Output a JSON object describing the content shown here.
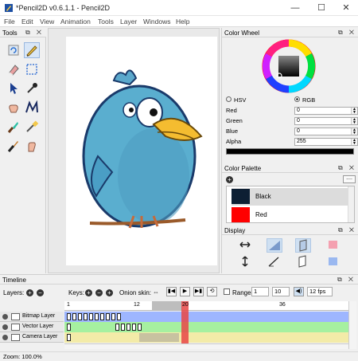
{
  "window": {
    "title": "*Pencil2D v0.6.1.1 - Pencil2D",
    "minimize": "—",
    "maximize": "☐",
    "close": "✕"
  },
  "menu": [
    "File",
    "Edit",
    "View",
    "Animation",
    "Tools",
    "Layer",
    "Windows",
    "Help"
  ],
  "panel_buttons": "⧉ ✕",
  "tools_panel": {
    "title": "Tools"
  },
  "color_wheel": {
    "title": "Color Wheel",
    "hsv_label": "HSV",
    "rgb_label": "RGB",
    "red_label": "Red",
    "red_value": "0",
    "green_label": "Green",
    "green_value": "0",
    "blue_label": "Blue",
    "blue_value": "0",
    "alpha_label": "Alpha",
    "alpha_value": "255",
    "current_color": "#000000"
  },
  "color_palette": {
    "title": "Color Palette",
    "add": "+",
    "menu": "....",
    "items": [
      {
        "name": "Black",
        "color": "#0d1f33"
      },
      {
        "name": "Red",
        "color": "#ff0000"
      }
    ]
  },
  "display": {
    "title": "Display"
  },
  "timeline": {
    "title": "Timeline",
    "layers_label": "Layers:",
    "add": "+",
    "remove": "−",
    "keys_label": "Keys:",
    "onion_label": "Onion skin:",
    "range_label": "Range",
    "range_start": "1",
    "range_end": "10",
    "fps": "12 fps",
    "ruler": [
      "1",
      "12",
      "20",
      "36"
    ],
    "current_frame": 20,
    "layers": [
      {
        "name": "Bitmap Layer",
        "color": "#9eb6ff"
      },
      {
        "name": "Vector Layer",
        "color": "#a6f0a0"
      },
      {
        "name": "Camera Layer",
        "color": "#f3eba8"
      }
    ]
  },
  "status": {
    "zoom": "Zoom: 100.0%"
  }
}
